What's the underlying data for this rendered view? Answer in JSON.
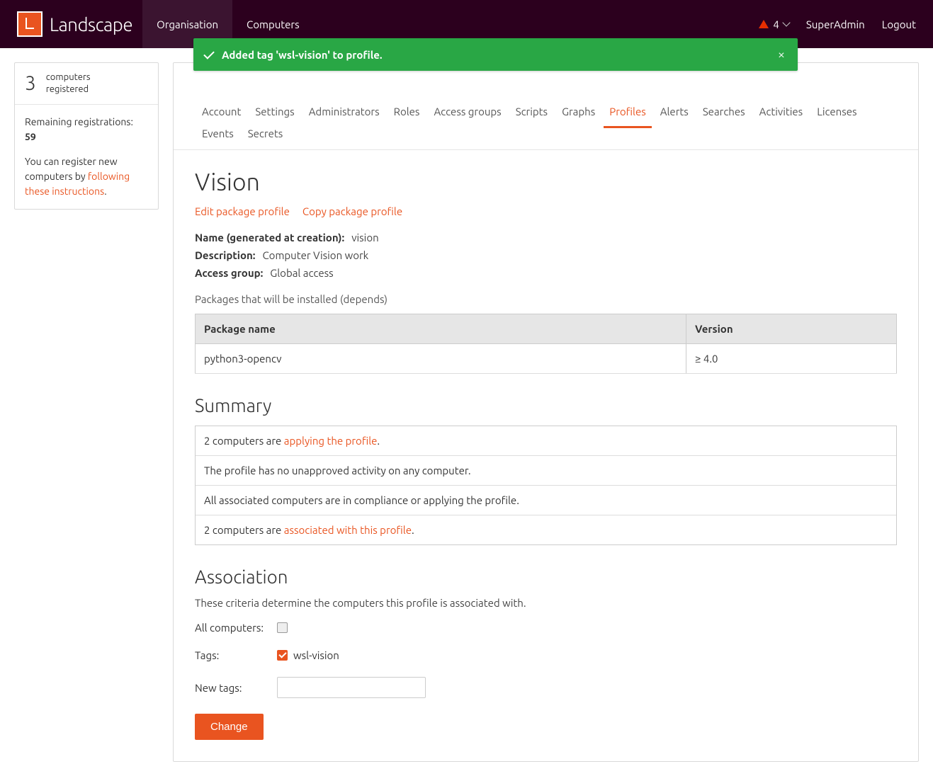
{
  "header": {
    "brand": "Landscape",
    "nav": {
      "organisation": "Organisation",
      "computers": "Computers"
    },
    "alert_count": "4",
    "user": "SuperAdmin",
    "logout": "Logout"
  },
  "sidebar": {
    "count": "3",
    "count_label_l1": "computers",
    "count_label_l2": "registered",
    "remaining_label": "Remaining registrations:",
    "remaining_value": "59",
    "register_prefix": "You can register new computers by ",
    "register_link": "following these instructions",
    "register_suffix": "."
  },
  "notification": {
    "message": "Added tag 'wsl-vision' to profile."
  },
  "tabs": {
    "account": "Account",
    "settings": "Settings",
    "administrators": "Administrators",
    "roles": "Roles",
    "access_groups": "Access groups",
    "scripts": "Scripts",
    "graphs": "Graphs",
    "profiles": "Profiles",
    "alerts": "Alerts",
    "searches": "Searches",
    "activities": "Activities",
    "licenses": "Licenses",
    "events": "Events",
    "secrets": "Secrets"
  },
  "profile": {
    "title": "Vision",
    "edit_link": "Edit package profile",
    "copy_link": "Copy package profile",
    "name_label": "Name (generated at creation):",
    "name_value": "vision",
    "desc_label": "Description:",
    "desc_value": "Computer Vision work",
    "access_label": "Access group:",
    "access_value": "Global access",
    "packages_caption": "Packages that will be installed (depends)",
    "table": {
      "col_package": "Package name",
      "col_version": "Version",
      "rows": [
        {
          "name": "python3-opencv",
          "version": "≥ 4.0"
        }
      ]
    }
  },
  "summary": {
    "heading": "Summary",
    "row1_prefix": "2 computers are ",
    "row1_link": "applying the profile",
    "row1_suffix": ".",
    "row2": "The profile has no unapproved activity on any computer.",
    "row3": "All associated computers are in compliance or applying the profile.",
    "row4_prefix": "2 computers are ",
    "row4_link": "associated with this profile",
    "row4_suffix": "."
  },
  "association": {
    "heading": "Association",
    "desc": "These criteria determine the computers this profile is associated with.",
    "all_label": "All computers:",
    "tags_label": "Tags:",
    "tag_value": "wsl-vision",
    "new_tags_label": "New tags:",
    "new_tags_value": "",
    "button": "Change"
  }
}
